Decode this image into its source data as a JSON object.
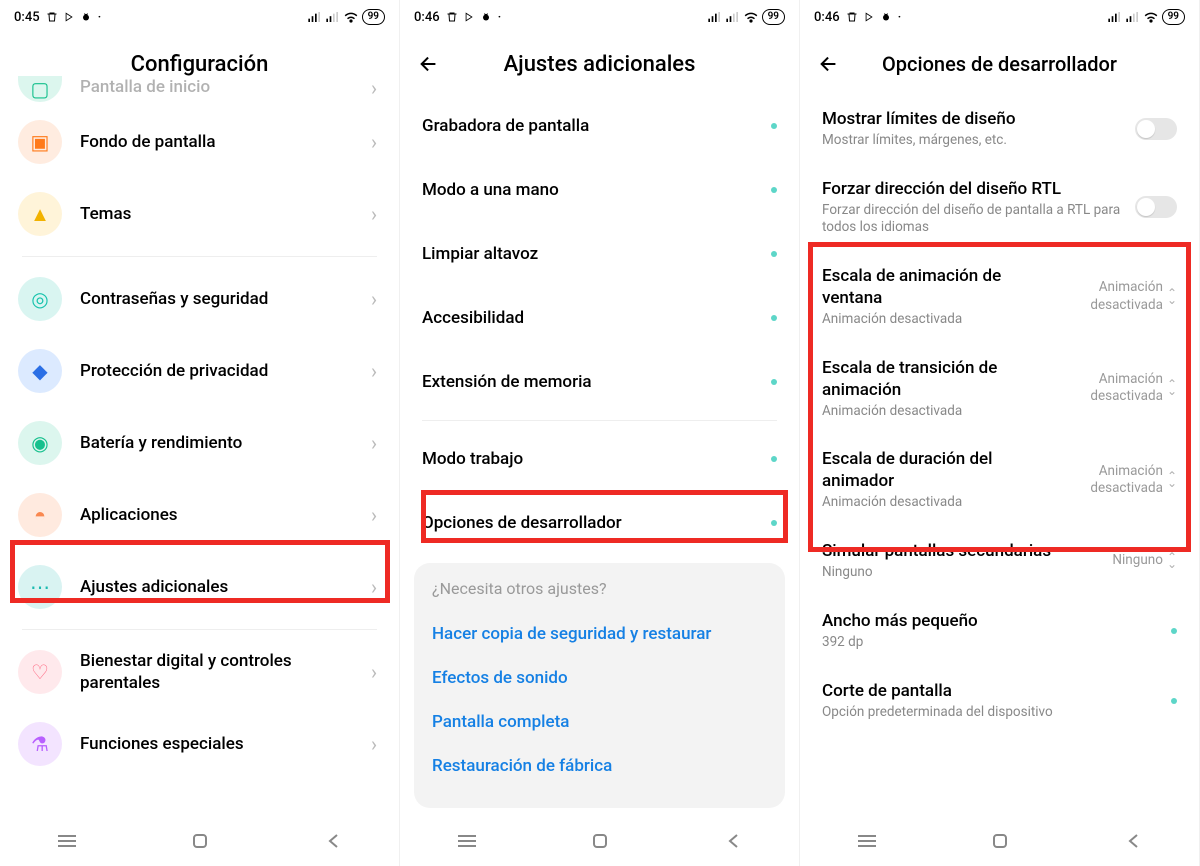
{
  "screen1": {
    "status": {
      "time": "0:45",
      "battery": "99"
    },
    "title": "Configuración",
    "rows": [
      {
        "label": "Pantalla de inicio",
        "icon": "home-icon",
        "iconClass": "ic-green",
        "cut": true
      },
      {
        "label": "Fondo de pantalla",
        "icon": "wallpaper-icon",
        "iconClass": "ic-orange"
      },
      {
        "label": "Temas",
        "icon": "theme-icon",
        "iconClass": "ic-yellow"
      }
    ],
    "rows2": [
      {
        "label": "Contraseñas y seguridad",
        "icon": "security-icon",
        "iconClass": "ic-teal"
      },
      {
        "label": "Protección de privacidad",
        "icon": "privacy-icon",
        "iconClass": "ic-blue"
      },
      {
        "label": "Batería y rendimiento",
        "icon": "battery-icon",
        "iconClass": "ic-green"
      },
      {
        "label": "Aplicaciones",
        "icon": "apps-icon",
        "iconClass": "ic-peach"
      },
      {
        "label": "Ajustes adicionales",
        "icon": "additional-icon",
        "iconClass": "ic-cyan",
        "highlight": true
      }
    ],
    "rows3": [
      {
        "label": "Bienestar digital y controles parentales",
        "icon": "wellbeing-icon",
        "iconClass": "ic-pink"
      },
      {
        "label": "Funciones especiales",
        "icon": "special-icon",
        "iconClass": "ic-purple"
      }
    ]
  },
  "screen2": {
    "status": {
      "time": "0:46",
      "battery": "99"
    },
    "title": "Ajustes adicionales",
    "rows": [
      {
        "label": "Grabadora de pantalla"
      },
      {
        "label": "Modo a una mano"
      },
      {
        "label": "Limpiar altavoz"
      },
      {
        "label": "Accesibilidad"
      },
      {
        "label": "Extensión de memoria"
      }
    ],
    "rows2": [
      {
        "label": "Modo trabajo"
      },
      {
        "label": "Opciones de desarrollador",
        "highlight": true
      }
    ],
    "suggestion": {
      "ask": "¿Necesita otros ajustes?",
      "links": [
        "Hacer copia de seguridad y restaurar",
        "Efectos de sonido",
        "Pantalla completa",
        "Restauración de fábrica"
      ]
    }
  },
  "screen3": {
    "status": {
      "time": "0:46",
      "battery": "99"
    },
    "title": "Opciones de desarrollador",
    "toggles": [
      {
        "label": "Mostrar límites de diseño",
        "sub": "Mostrar límites, márgenes, etc."
      },
      {
        "label": "Forzar dirección del diseño RTL",
        "sub": "Forzar dirección del diseño de pantalla a RTL para todos los idiomas"
      }
    ],
    "anim": [
      {
        "label": "Escala de animación de ventana",
        "sub": "Animación desactivada",
        "value": "Animación desactivada"
      },
      {
        "label": "Escala de transición de animación",
        "sub": "Animación desactivada",
        "value": "Animación desactivada"
      },
      {
        "label": "Escala de duración del animador",
        "sub": "Animación desactivada",
        "value": "Animación desactivada"
      }
    ],
    "after": [
      {
        "label": "Simular pantallas secundarias",
        "sub": "Ninguno",
        "value": "Ninguno",
        "valueSimple": true
      },
      {
        "label": "Ancho más pequeño",
        "sub": "392 dp",
        "dot": true
      },
      {
        "label": "Corte de pantalla",
        "sub": "Opción predeterminada del dispositivo",
        "dot": true
      }
    ]
  }
}
